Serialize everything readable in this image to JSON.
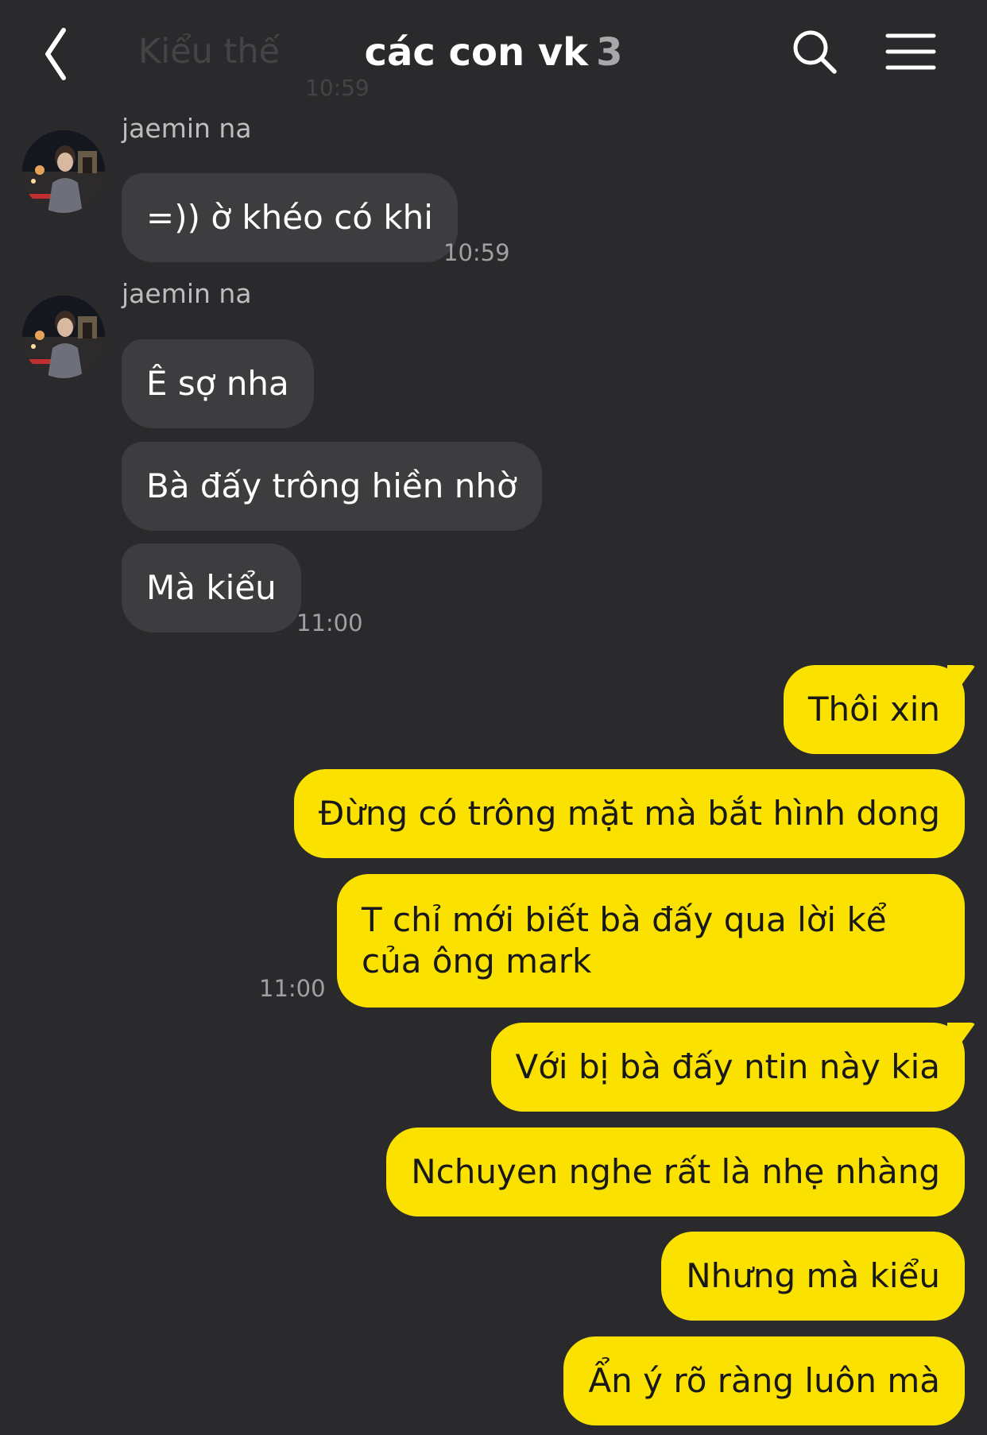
{
  "header": {
    "back_icon": "chevron-left-icon",
    "ghost_text": "Kiểu thế",
    "ghost_time": "10:59",
    "title": "các con vk",
    "member_count": "3",
    "search_icon": "search-icon",
    "menu_icon": "hamburger-menu-icon"
  },
  "messages": {
    "group1": {
      "sender": "jaemin na",
      "m1": "=)) ờ khéo có khi",
      "time": "10:59"
    },
    "group2": {
      "sender": "jaemin na",
      "m1": "Ê sợ nha",
      "m2": "Bà đấy trông hiền nhờ",
      "m3": "Mà kiểu",
      "time": "11:00"
    },
    "outgoing1": {
      "m1": "Thôi xin",
      "m2": "Đừng có trông mặt mà bắt hình dong",
      "m3": "T chỉ mới biết bà đấy qua lời kể của ông mark",
      "time": "11:00"
    },
    "outgoing2": {
      "m1": "Với bị bà đấy ntin này kia",
      "m2": "Nchuyen nghe rất là nhẹ nhàng",
      "m3": "Nhưng mà kiểu",
      "m4": "Ẩn ý rõ ràng luôn mà"
    }
  },
  "colors": {
    "background": "#2a2a2c",
    "incoming_bubble": "#3d3d40",
    "outgoing_bubble": "#fae100"
  }
}
